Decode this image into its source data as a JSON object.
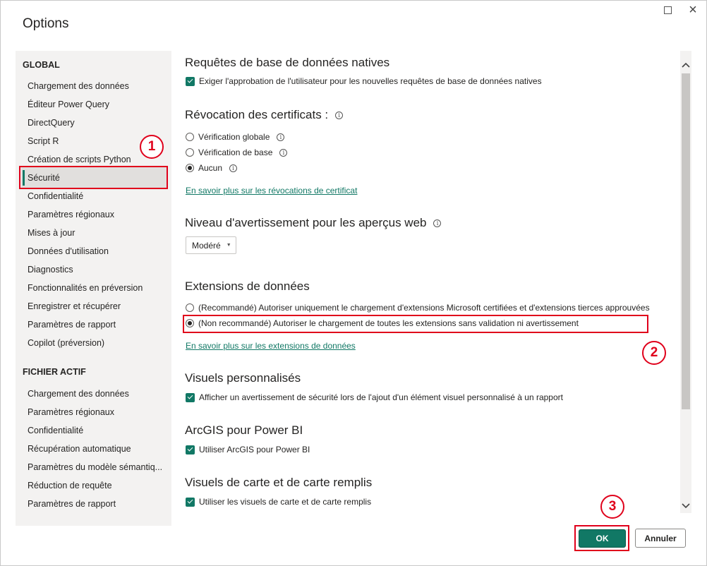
{
  "window": {
    "title": "Options"
  },
  "sidebar": {
    "global_heading": "GLOBAL",
    "global_items": [
      "Chargement des données",
      "Éditeur Power Query",
      "DirectQuery",
      "Script R",
      "Création de scripts Python",
      "Sécurité",
      "Confidentialité",
      "Paramètres régionaux",
      "Mises à jour",
      "Données d'utilisation",
      "Diagnostics",
      "Fonctionnalités en préversion",
      "Enregistrer et récupérer",
      "Paramètres de rapport",
      "Copilot (préversion)"
    ],
    "file_heading": "FICHIER ACTIF",
    "file_items": [
      "Chargement des données",
      "Paramètres régionaux",
      "Confidentialité",
      "Récupération automatique",
      "Paramètres du modèle sémantiq...",
      "Réduction de requête",
      "Paramètres de rapport"
    ],
    "selected": "Sécurité"
  },
  "content": {
    "native_queries": {
      "title": "Requêtes de base de données natives",
      "checkbox": "Exiger l'approbation de l'utilisateur pour les nouvelles requêtes de base de données natives"
    },
    "cert_revocation": {
      "title": "Révocation des certificats :",
      "options": [
        "Vérification globale",
        "Vérification de base",
        "Aucun"
      ],
      "selected": "Aucun",
      "link": "En savoir plus sur les révocations de certificat"
    },
    "web_preview": {
      "title": "Niveau d'avertissement pour les aperçus web",
      "dropdown_value": "Modéré"
    },
    "data_extensions": {
      "title": "Extensions de données",
      "option_recommended": "(Recommandé) Autoriser uniquement le chargement d'extensions Microsoft certifiées et d'extensions tierces approuvées",
      "option_not_recommended": "(Non recommandé) Autoriser le chargement de toutes les extensions sans validation ni avertissement",
      "selected": "(Non recommandé) Autoriser le chargement de toutes les extensions sans validation ni avertissement",
      "link": "En savoir plus sur les extensions de données"
    },
    "custom_visuals": {
      "title": "Visuels personnalisés",
      "checkbox": "Afficher un avertissement de sécurité lors de l'ajout d'un élément visuel personnalisé à un rapport"
    },
    "arcgis": {
      "title": "ArcGIS pour Power BI",
      "checkbox": "Utiliser ArcGIS pour Power BI"
    },
    "maps": {
      "title": "Visuels de carte et de carte remplis",
      "checkbox": "Utiliser les visuels de carte et de carte remplis"
    }
  },
  "footer": {
    "ok_label": "OK",
    "cancel_label": "Annuler"
  },
  "annotations": [
    "1",
    "2",
    "3"
  ],
  "icons": {
    "info": "i",
    "maximize": "maximize-icon",
    "close": "×",
    "scroll_up": "▲",
    "scroll_down": "▼",
    "caret": "▼"
  },
  "colors": {
    "accent": "#117865",
    "annotation": "#e0001b",
    "sidebar_bg": "#f3f2f1",
    "selected_bg": "#e1dfdd"
  }
}
